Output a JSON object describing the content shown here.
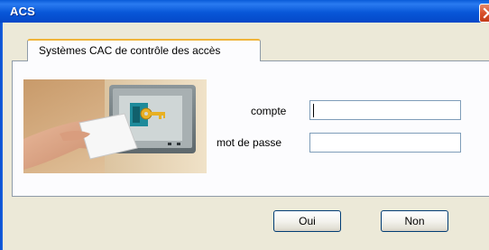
{
  "window": {
    "title": "ACS",
    "close_icon": "close-icon"
  },
  "tabs": [
    {
      "label": "Systèmes CAC de contrôle des accès",
      "selected": true
    }
  ],
  "illustration": {
    "icon": "access-card-reader-key-icon"
  },
  "form": {
    "account_label": "compte",
    "account_value": "",
    "password_label": "mot de passe",
    "password_value": ""
  },
  "buttons": {
    "yes_label": "Oui",
    "no_label": "Non"
  },
  "colors": {
    "titlebar": "#0a5cd8",
    "dialog_background": "#ece9d8",
    "panel_background": "#fcfcfe",
    "tab_highlight": "#f0b43a",
    "key_card_teal": "#1e8a9a",
    "key_gold": "#e8b024"
  }
}
